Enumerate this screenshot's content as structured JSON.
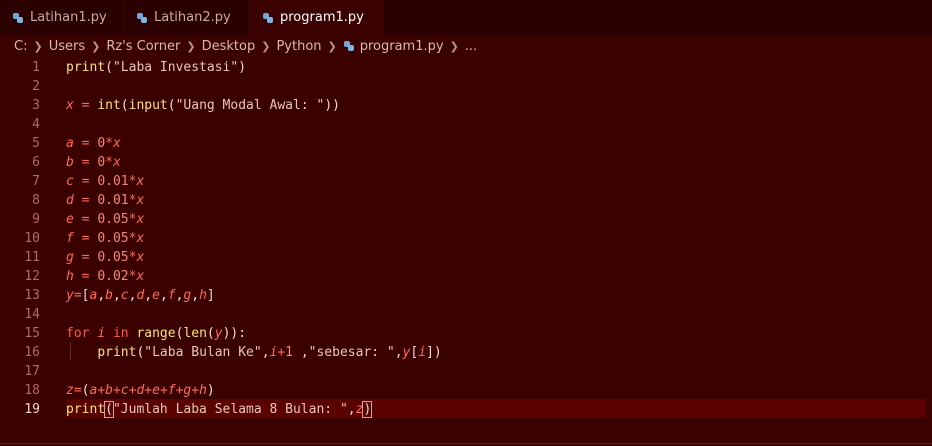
{
  "tabs": [
    {
      "label": "Latihan1.py",
      "icon": "python-icon"
    },
    {
      "label": "Latihan2.py",
      "icon": "python-icon"
    },
    {
      "label": "program1.py",
      "icon": "python-icon",
      "active": true,
      "unsaved": true
    }
  ],
  "breadcrumb": {
    "parts": [
      "C:",
      "Users",
      "Rz's Corner",
      "Desktop",
      "Python",
      "program1.py",
      "..."
    ]
  },
  "line_numbers": [
    "1",
    "2",
    "3",
    "4",
    "5",
    "6",
    "7",
    "8",
    "9",
    "10",
    "11",
    "12",
    "13",
    "14",
    "15",
    "16",
    "17",
    "18",
    "19"
  ],
  "code": {
    "l1_fn": "print",
    "l1_str": "\"Laba Investasi\"",
    "l3_var": "x",
    "l3_fn1": "int",
    "l3_fn2": "input",
    "l3_str": "\"Uang Modal Awal: \"",
    "l5_var": "a",
    "l5_num": "0",
    "l5_var2": "x",
    "l6_var": "b",
    "l6_num": "0",
    "l6_var2": "x",
    "l7_var": "c",
    "l7_num": "0.01",
    "l7_var2": "x",
    "l8_var": "d",
    "l8_num": "0.01",
    "l8_var2": "x",
    "l9_var": "e",
    "l9_num": "0.05",
    "l9_var2": "x",
    "l10_var": "f",
    "l10_num": "0.05",
    "l10_var2": "x",
    "l11_var": "g",
    "l11_num": "0.05",
    "l11_var2": "x",
    "l12_var": "h",
    "l12_num": "0.02",
    "l12_var2": "x",
    "l13_var": "y",
    "l15_kw1": "for",
    "l15_var": "i",
    "l15_kw2": "in",
    "l15_fn1": "range",
    "l15_fn2": "len",
    "l15_var2": "y",
    "l16_fn": "print",
    "l16_str1": "\"Laba Bulan Ke\"",
    "l16_var": "i",
    "l16_num": "1",
    "l16_str2": "\"sebesar: \"",
    "l16_var2": "y",
    "l16_var3": "i",
    "l18_var": "z",
    "l19_fn": "print",
    "l19_str": "\"Jumlah Laba Selama 8 Bulan: \"",
    "l19_var": "z"
  },
  "colors": {
    "background": "#3b0000",
    "tabbar": "#2a0000",
    "function": "#f7e27a",
    "variable": "#ff6b55",
    "number": "#f08a7a",
    "string": "#e7c7b8"
  }
}
